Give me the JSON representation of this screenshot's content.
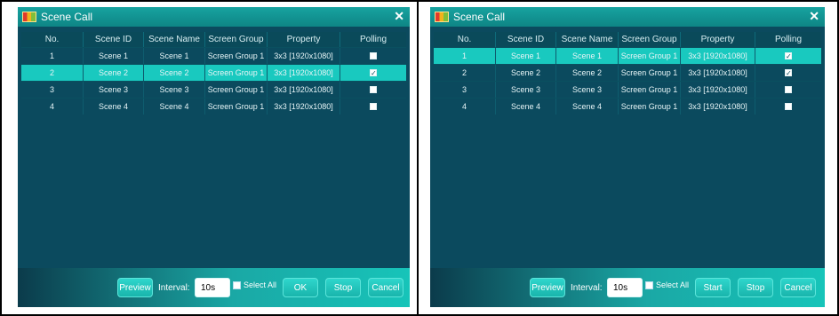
{
  "left": {
    "title": "Scene Call",
    "columns": [
      "No.",
      "Scene ID",
      "Scene Name",
      "Screen Group",
      "Property",
      "Polling"
    ],
    "rows": [
      {
        "no": "1",
        "id": "Scene 1",
        "name": "Scene 1",
        "group": "Screen Group 1",
        "prop": "3x3 [1920x1080]",
        "polling": false,
        "selected": false
      },
      {
        "no": "2",
        "id": "Scene 2",
        "name": "Scene 2",
        "group": "Screen Group 1",
        "prop": "3x3 [1920x1080]",
        "polling": true,
        "selected": true
      },
      {
        "no": "3",
        "id": "Scene 3",
        "name": "Scene 3",
        "group": "Screen Group 1",
        "prop": "3x3 [1920x1080]",
        "polling": false,
        "selected": false
      },
      {
        "no": "4",
        "id": "Scene 4",
        "name": "Scene 4",
        "group": "Screen Group 1",
        "prop": "3x3 [1920x1080]",
        "polling": false,
        "selected": false
      }
    ],
    "buttons": {
      "preview": "Preview",
      "interval_label": "Interval:",
      "interval_value": "10s",
      "select_all": "Select All",
      "ok": "OK",
      "stop": "Stop",
      "cancel": "Cancel"
    }
  },
  "right": {
    "title": "Scene Call",
    "columns": [
      "No.",
      "Scene ID",
      "Scene Name",
      "Screen Group",
      "Property",
      "Polling"
    ],
    "rows": [
      {
        "no": "1",
        "id": "Scene 1",
        "name": "Scene 1",
        "group": "Screen Group 1",
        "prop": "3x3 [1920x1080]",
        "polling": true,
        "selected": true
      },
      {
        "no": "2",
        "id": "Scene 2",
        "name": "Scene 2",
        "group": "Screen Group 1",
        "prop": "3x3 [1920x1080]",
        "polling": true,
        "selected": false
      },
      {
        "no": "3",
        "id": "Scene 3",
        "name": "Scene 3",
        "group": "Screen Group 1",
        "prop": "3x3 [1920x1080]",
        "polling": false,
        "selected": false
      },
      {
        "no": "4",
        "id": "Scene 4",
        "name": "Scene 4",
        "group": "Screen Group 1",
        "prop": "3x3 [1920x1080]",
        "polling": false,
        "selected": false
      }
    ],
    "buttons": {
      "preview": "Preview",
      "interval_label": "Interval:",
      "interval_value": "10s",
      "select_all": "Select All",
      "start": "Start",
      "stop": "Stop",
      "cancel": "Cancel"
    }
  },
  "icons": {
    "app": "app-grid-icon",
    "close": "close-icon",
    "close_glyph": "✕",
    "check_glyph": "✓"
  }
}
